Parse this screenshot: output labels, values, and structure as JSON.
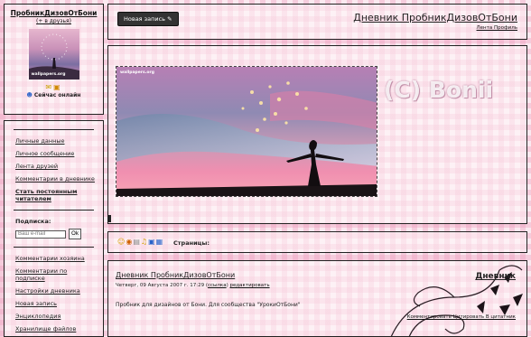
{
  "profile": {
    "username": "ПробникДизовОтБони",
    "add_friend": "(+ в друзья)",
    "online": "Сейчас онлайн",
    "avatar_watermark": "wallpapers.org"
  },
  "nav": {
    "group1": [
      "Личные данные",
      "Личное сообщение",
      "Лента друзей",
      "Комментарии в дневнике"
    ],
    "regular_reader": "Стать постоянным читателем",
    "subscription_label": "Подписка:",
    "email_placeholder": "Ваш e-mail",
    "ok_label": "Ok",
    "group2": [
      "Комментарии хозяина",
      "Комментарии по подписке",
      "Настройки дневника",
      "Новая запись",
      "Энциклопедия",
      "Хранилище файлов"
    ]
  },
  "header": {
    "new_entry": "Новая запись",
    "title": "Дневник ПробникДизовОтБони",
    "links": "Лента  Профиль"
  },
  "photo": {
    "small_tag": "wallpapers.org",
    "watermark": "(C) Bonii"
  },
  "toolbar": {
    "pages_label": "Страницы:"
  },
  "entry": {
    "title": "Дневник ПробникДизовОтБони",
    "meta_prefix": "Четверг, 09 Августа 2007 г. 17:29 (",
    "meta_link": "ссылка",
    "meta_suffix": ") ",
    "meta_edit": "редактировать",
    "body": "Пробник для дизайнов от Бони. Для сообщества \"УрокиОтБони\"",
    "right_title": "Дневник",
    "links": "Комментировать   Цитировать   В цитатник"
  }
}
